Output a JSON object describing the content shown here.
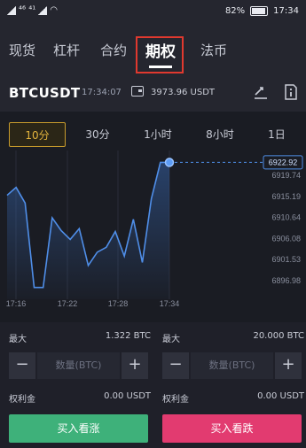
{
  "status_bar": {
    "signal_text": "⁴⁶ ⁴¹",
    "battery": "82%",
    "time": "17:34"
  },
  "tabs": [
    "现货",
    "杠杆",
    "合约",
    "期权",
    "法币"
  ],
  "header": {
    "pair": "BTCUSDT",
    "time": "17:34:07",
    "balance": "3973.96 USDT",
    "icons": [
      "swap-icon",
      "info-icon"
    ]
  },
  "periods": [
    "10分",
    "30分",
    "1小时",
    "8小时",
    "1日"
  ],
  "active_period": 0,
  "chart_data": {
    "type": "line",
    "x_labels": [
      "17:16",
      "17:22",
      "17:28",
      "17:34"
    ],
    "y_ticks": [
      "6919.74",
      "6915.19",
      "6910.64",
      "6906.08",
      "6901.53",
      "6896.98"
    ],
    "current_price": "6922.92",
    "values": [
      6916.2,
      6917.8,
      6914.6,
      6897.4,
      6897.4,
      6911.6,
      6909.0,
      6907.2,
      6909.4,
      6901.9,
      6904.6,
      6905.6,
      6908.8,
      6903.8,
      6911.3,
      6902.5,
      6915.5,
      6922.9,
      6922.9
    ],
    "ylim": [
      6895.0,
      6924.6
    ],
    "line_color": "#4f8ee8"
  },
  "trade": {
    "left": {
      "max_label": "最大",
      "max_value": "1.322 BTC",
      "placeholder": "数量(BTC)",
      "premium_label": "权利金",
      "premium_value": "0.00 USDT",
      "button": "买入看涨",
      "color": "#3eb17a"
    },
    "right": {
      "max_label": "最大",
      "max_value": "20.000 BTC",
      "placeholder": "数量(BTC)",
      "premium_label": "权利金",
      "premium_value": "0.00 USDT",
      "button": "买入看跌",
      "color": "#e23b70"
    }
  }
}
